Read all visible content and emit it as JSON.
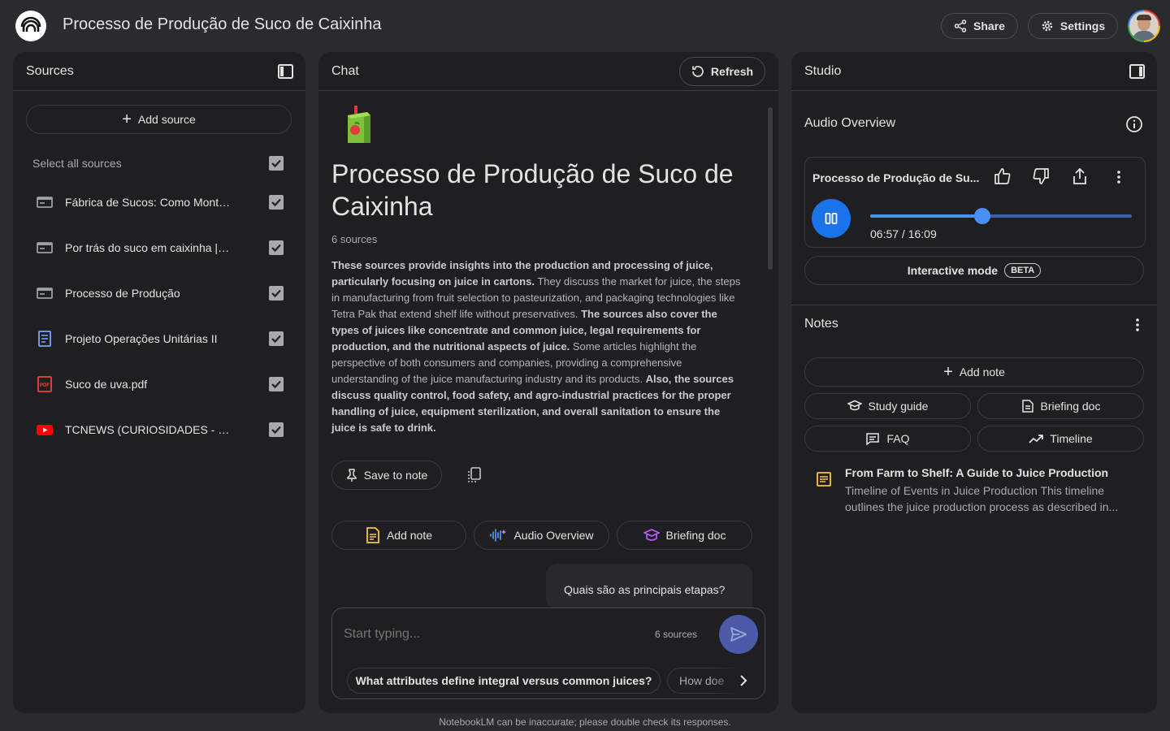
{
  "header": {
    "title": "Processo de Produção de Suco de Caixinha",
    "share_label": "Share",
    "settings_label": "Settings"
  },
  "sources": {
    "title": "Sources",
    "add_label": "Add source",
    "select_all_label": "Select all sources",
    "items": [
      {
        "label": "Fábrica de Sucos: Como Montar a ...",
        "icon": "web-icon",
        "checked": true
      },
      {
        "label": "Por trás do suco em caixinha | Veja...",
        "icon": "web-icon",
        "checked": true
      },
      {
        "label": "Processo de Produção",
        "icon": "web-icon",
        "checked": true
      },
      {
        "label": "Projeto Operações Unitárias II",
        "icon": "doc-icon",
        "checked": true
      },
      {
        "label": "Suco de uva.pdf",
        "icon": "pdf-icon",
        "checked": true
      },
      {
        "label": "TCNEWS (CURIOSIDADES - COMO ...",
        "icon": "youtube-icon",
        "checked": true
      }
    ]
  },
  "chat": {
    "title": "Chat",
    "refresh_label": "Refresh",
    "notebook_title": "Processo de Produção de Suco de Caixinha",
    "source_count": "6 sources",
    "summary": [
      {
        "bold": true,
        "text": "These sources provide insights into the production and processing of juice, particularly focusing on juice in cartons."
      },
      {
        "bold": false,
        "text": " They discuss the market for juice, the steps in manufacturing from fruit selection to pasteurization, and packaging technologies like Tetra Pak that extend shelf life without preservatives. "
      },
      {
        "bold": true,
        "text": "The sources also cover the types of juices like concentrate and common juice, legal requirements for production, and the nutritional aspects of juice."
      },
      {
        "bold": false,
        "text": " Some articles highlight the perspective of both consumers and companies, providing a comprehensive understanding of the juice manufacturing industry and its products. "
      },
      {
        "bold": true,
        "text": "Also, the sources discuss quality control, food safety, and agro-industrial practices for the proper handling of juice, equipment sterilization, and overall sanitation to ensure the juice is safe to drink."
      }
    ],
    "save_to_note_label": "Save to note",
    "actions": {
      "add_note": "Add note",
      "audio_overview": "Audio Overview",
      "briefing_doc": "Briefing doc"
    },
    "user_message": "Quais são as principais etapas?",
    "input_placeholder": "Start typing...",
    "input_sources": "6 sources",
    "suggestions": [
      "What attributes define integral versus common juices?",
      "How doe"
    ]
  },
  "studio": {
    "title": "Studio",
    "audio_overview_title": "Audio Overview",
    "player": {
      "title": "Processo de Produção de Su...",
      "time": "06:57 / 16:09",
      "progress": 0.43
    },
    "interactive_label": "Interactive mode",
    "beta_label": "BETA",
    "notes_title": "Notes",
    "add_note_label": "Add note",
    "buttons": {
      "study_guide": "Study guide",
      "briefing_doc": "Briefing doc",
      "faq": "FAQ",
      "timeline": "Timeline"
    },
    "note": {
      "title": "From Farm to Shelf: A Guide to Juice Production",
      "preview": "Timeline of Events in Juice Production This timeline outlines the juice production process as described in..."
    }
  },
  "footer": {
    "disclaimer": "NotebookLM can be inaccurate; please double check its responses."
  },
  "colors": {
    "background": "#2a2b2e",
    "panel": "#1f1f21",
    "accent_blue": "#4b8ff5",
    "play_blue": "#1a73e8",
    "send_button": "#4a5aa8"
  }
}
